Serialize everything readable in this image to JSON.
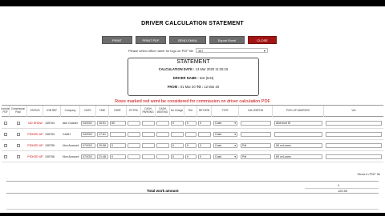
{
  "title": "DRIVER CALCULATION STATEMENT",
  "buttons": [
    {
      "label": "PRINT",
      "name": "print-button"
    },
    {
      "label": "PRINT PDF",
      "name": "print-pdf-button"
    },
    {
      "label": "SEND EMAIL",
      "name": "send-email-button"
    },
    {
      "label": "Export Excel",
      "name": "export-excel-button"
    },
    {
      "label": "CLOSE",
      "name": "close-button"
    }
  ],
  "logo_select": {
    "label": "Please select office name for logo on PDF file",
    "value": "387"
  },
  "statement": {
    "heading": "STATEMENT",
    "calc_date_label": "CALCULATION DATE :",
    "calc_date_value": "13 Mar 2020 11:25:16",
    "driver_label": "DRIVER NAME :",
    "driver_value": "test (test)",
    "from_label": "FROM :",
    "from_value": "01 Mar 20",
    "to_label": "TO :",
    "to_value": "12 Mar 20"
  },
  "warning": "Rows marked red wont be considered for commission on driver calculation PDF",
  "table": {
    "headers": [
      "Include PDF",
      "Commission Paid",
      "STATUS",
      "JOB REF",
      "Company",
      "DATE",
      "TIME",
      "FARE",
      "EXTRA",
      "CASH PARKING",
      "CASH WAITING",
      "No Charge",
      "Ret",
      "RETURN",
      "TYPE",
      "CALLERPHN",
      "PICK-UP ADDRESS",
      "VIA"
    ],
    "rows": [
      {
        "status": "NO SHOW",
        "jobref": "135754",
        "company": "Alle Charter",
        "date": "04/03/2",
        "time": "16:51",
        "fare": "80",
        "nocharge": "0",
        "ret": "0",
        "return": "0",
        "type": "Cash",
        "caller": "",
        "pickup": "Abertord  St"
      },
      {
        "status": "PICKED UP",
        "jobref": "135753",
        "company": "CASH",
        "date": "04/03/2",
        "time": "17:51",
        "fare": "",
        "nocharge": "",
        "ret": "",
        "return": "",
        "type": "Cash",
        "caller": "",
        "pickup": ""
      },
      {
        "status": "PICKED UP",
        "jobref": "135755",
        "company": "Non Account",
        "date": "07/03/2",
        "time": "20:58",
        "fare": "0",
        "nocharge": "0",
        "ret": "0",
        "return": "0",
        "type": "Cash",
        "caller": "Pdl",
        "pickup": "55  ceLuano"
      },
      {
        "status": "PICKED UP",
        "jobref": "135756",
        "company": "Non Account",
        "date": "07/03/2",
        "time": "21:48",
        "fare": "0",
        "nocharge": "0",
        "ret": "0",
        "return": "0",
        "type": "Cash",
        "caller": "Pdl",
        "pickup": "69  ceLuano"
      }
    ]
  },
  "show_in_pdf": "Show in PDF fie",
  "totals": {
    "label": "Total work amount",
    "num": "1",
    "value": "120.00"
  },
  "colors": {
    "close_button": "#a31515",
    "gray_button": "#6d6d6d",
    "warning": "#cc0000"
  }
}
